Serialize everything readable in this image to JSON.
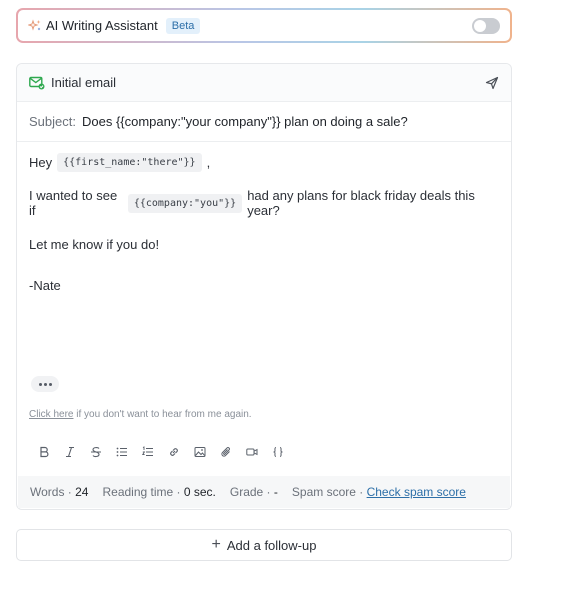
{
  "ai_assistant": {
    "title": "AI Writing Assistant",
    "badge": "Beta",
    "toggle_on": false,
    "icon": "sparkle-icon"
  },
  "email": {
    "title": "Initial email",
    "subject_label": "Subject:",
    "subject_value": "Does {{company:\"your company\"}} plan on doing a sale?",
    "body": {
      "line1_prefix": "Hey",
      "line1_var": "{{first_name:\"there\"}}",
      "line1_suffix": ",",
      "line2_prefix": "I wanted to see if",
      "line2_var": "{{company:\"you\"}}",
      "line2_suffix": "had any plans for black friday deals this year?",
      "line3": "Let me know if you do!",
      "line4": "-Nate"
    },
    "unsubscribe_link": "Click here",
    "unsubscribe_text": " if you don't want to hear from me again.",
    "toolbar": [
      "bold-icon",
      "italic-icon",
      "strikethrough-icon",
      "bullet-list-icon",
      "numbered-list-icon",
      "link-icon",
      "image-icon",
      "attachment-icon",
      "video-icon",
      "code-braces-icon"
    ],
    "stats": {
      "words_label": "Words · ",
      "words_value": "24",
      "reading_label": "Reading time · ",
      "reading_value": "0 sec.",
      "grade_label": "Grade · ",
      "grade_value": "-",
      "spam_label": "Spam score · ",
      "spam_link": "Check spam score"
    }
  },
  "followup": {
    "label": "Add a follow-up"
  },
  "colors": {
    "accent_link": "#2d6fa8",
    "mail_icon_green": "#2fa84f"
  }
}
